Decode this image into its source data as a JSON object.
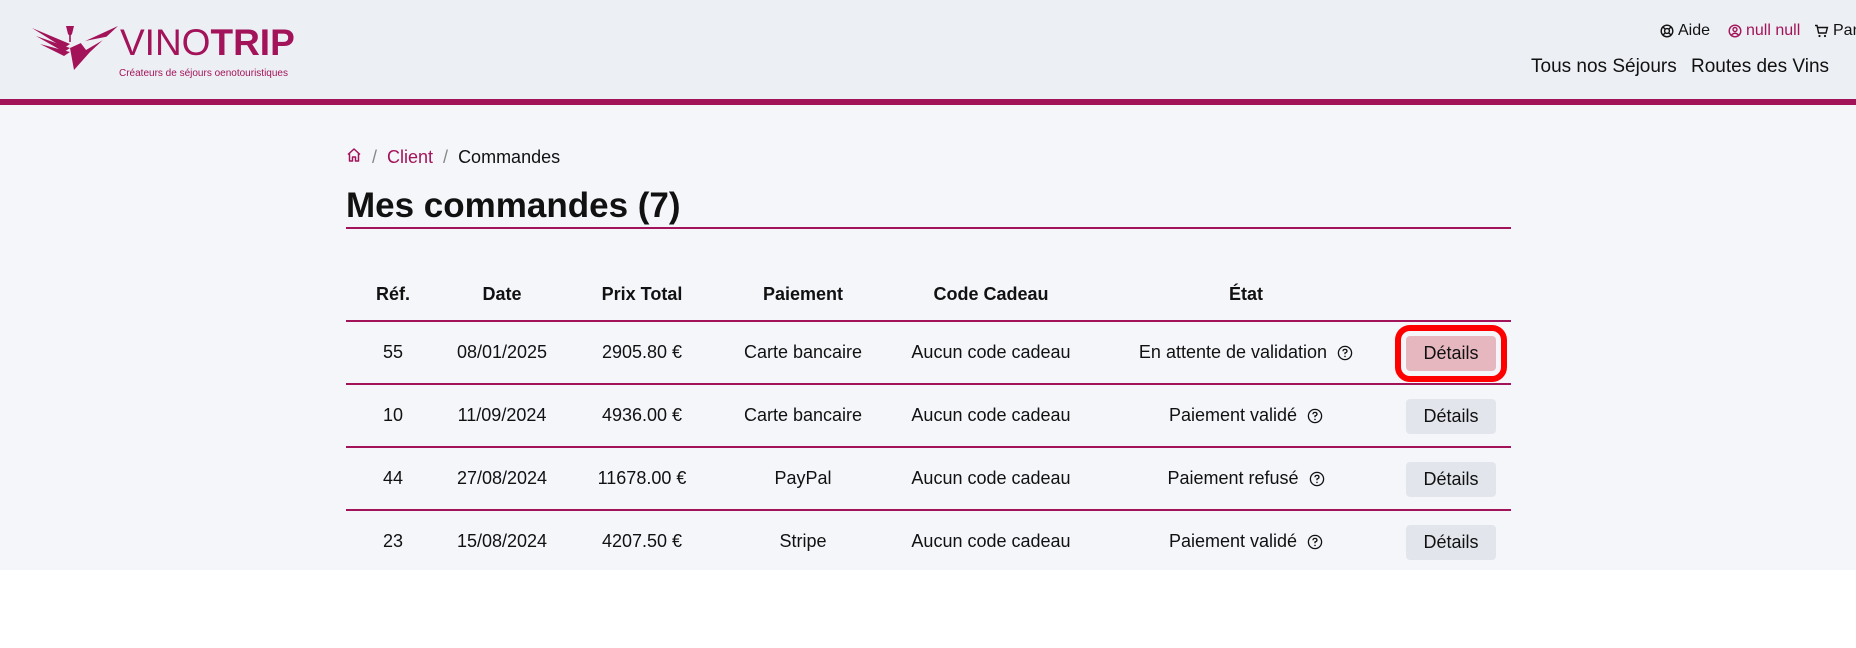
{
  "header": {
    "logo": {
      "vino": "VINO",
      "trip": "TRIP",
      "tagline": "Créateurs de séjours oenotouristiques"
    },
    "toplinks": {
      "aide": "Aide",
      "user": "null null",
      "panier": "Panier"
    },
    "nav": {
      "sejours": "Tous nos Séjours",
      "routes": "Routes des Vins"
    },
    "colors": {
      "brand": "#a3135a",
      "highlight": "#ff0000"
    }
  },
  "breadcrumb": {
    "home_icon": "home-icon",
    "client": "Client",
    "current": "Commandes",
    "separator": "/"
  },
  "main": {
    "title": "Mes commandes (7)"
  },
  "table": {
    "headers": {
      "ref": "Réf.",
      "date": "Date",
      "prix": "Prix Total",
      "paiement": "Paiement",
      "code": "Code Cadeau",
      "etat": "État"
    },
    "rows": [
      {
        "ref": "55",
        "date": "08/01/2025",
        "prix": "2905.80 €",
        "paiement": "Carte bancaire",
        "code": "Aucun code cadeau",
        "etat": "En attente de validation",
        "action": "Détails"
      },
      {
        "ref": "10",
        "date": "11/09/2024",
        "prix": "4936.00 €",
        "paiement": "Carte bancaire",
        "code": "Aucun code cadeau",
        "etat": "Paiement validé",
        "action": "Détails"
      },
      {
        "ref": "44",
        "date": "27/08/2024",
        "prix": "11678.00 €",
        "paiement": "PayPal",
        "code": "Aucun code cadeau",
        "etat": "Paiement refusé",
        "action": "Détails"
      },
      {
        "ref": "23",
        "date": "15/08/2024",
        "prix": "4207.50 €",
        "paiement": "Stripe",
        "code": "Aucun code cadeau",
        "etat": "Paiement validé",
        "action": "Détails"
      }
    ]
  }
}
